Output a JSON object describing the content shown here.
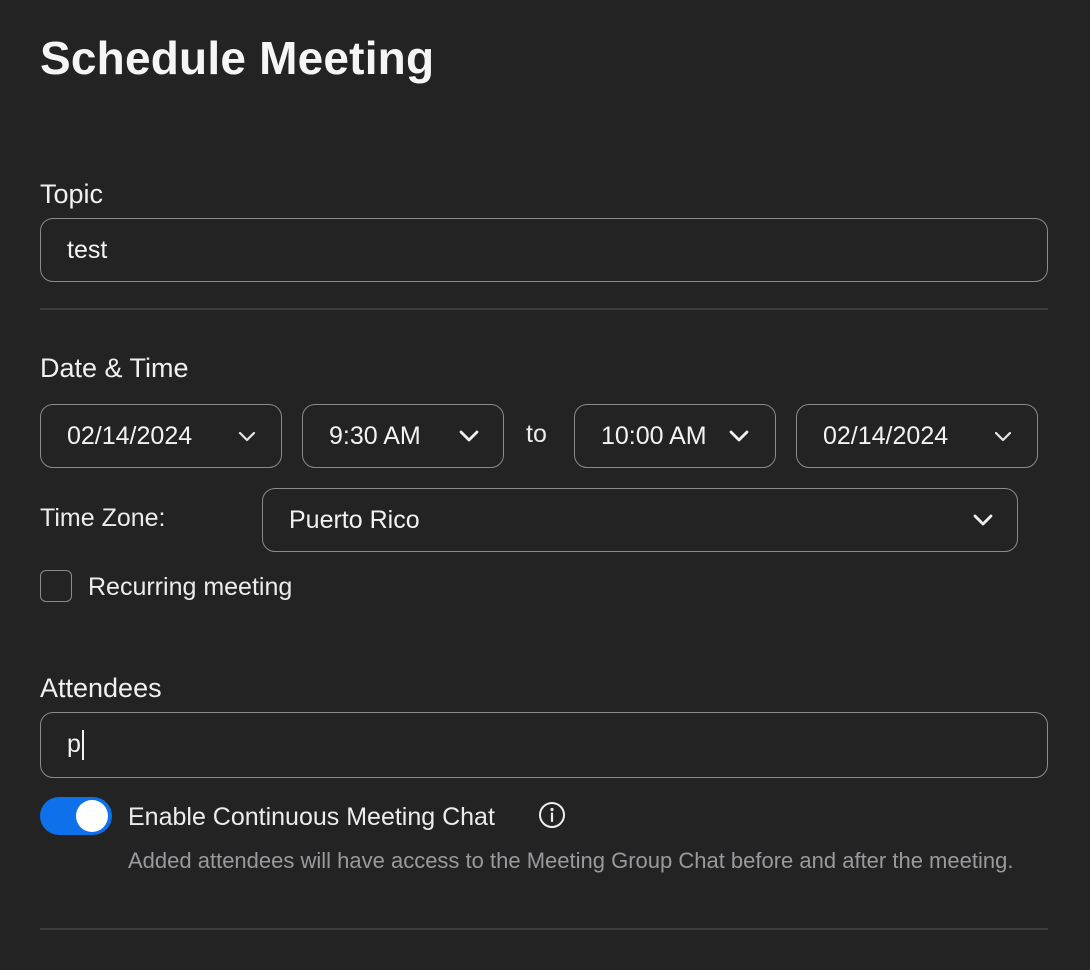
{
  "page": {
    "title": "Schedule Meeting"
  },
  "topic": {
    "label": "Topic",
    "value": "test"
  },
  "datetime": {
    "label": "Date & Time",
    "start_date": "02/14/2024",
    "start_time": "9:30 AM",
    "to_label": "to",
    "end_time": "10:00 AM",
    "end_date": "02/14/2024",
    "timezone_label": "Time Zone:",
    "timezone_value": "Puerto Rico",
    "recurring_label": "Recurring meeting",
    "recurring_checked": false
  },
  "attendees": {
    "label": "Attendees",
    "value": "p",
    "continuous_chat_label": "Enable Continuous Meeting Chat",
    "continuous_chat_enabled": true,
    "continuous_chat_help": "Added attendees will have access to the Meeting Group Chat before and after the meeting."
  },
  "icons": {
    "dropdown": "chevron-down-icon",
    "info": "info-icon"
  },
  "colors": {
    "background": "#232324",
    "accent": "#0e71eb",
    "border": "#8a8a8e",
    "muted_text": "#9a9a9e"
  }
}
